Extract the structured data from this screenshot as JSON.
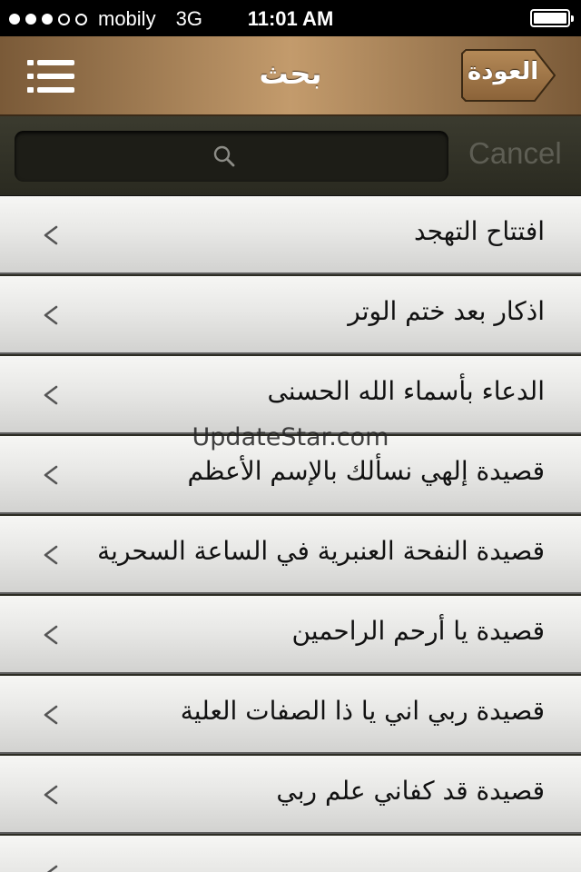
{
  "status_bar": {
    "carrier": "mobily",
    "network": "3G",
    "time": "11:01 AM",
    "signal_bars_filled": 3,
    "signal_bars_total": 5,
    "battery_level": 1.0
  },
  "navbar": {
    "title": "بحث",
    "back_label": "العودة",
    "menu_icon": "hamburger-menu-icon"
  },
  "search": {
    "placeholder": "",
    "value": "",
    "cancel_label": "Cancel",
    "icon": "search-icon"
  },
  "list": {
    "chevron_icon": "chevron-left-icon",
    "items": [
      {
        "label": "افتتاح التهجد"
      },
      {
        "label": "اذكار بعد ختم الوتر"
      },
      {
        "label": "الدعاء بأسماء الله الحسنى"
      },
      {
        "label": "قصيدة إلهي نسألك بالإسم الأعظم"
      },
      {
        "label": "قصيدة النفحة العنبرية في الساعة السحرية"
      },
      {
        "label": "قصيدة يا أرحم الراحمين"
      },
      {
        "label": "قصيدة ربي اني يا ذا الصفات العلية"
      },
      {
        "label": "قصيدة قد كفاني علم ربي"
      },
      {
        "label": ""
      }
    ]
  },
  "watermark": "UpdateStar.com",
  "colors": {
    "navbar_dark": "#7a5a38",
    "navbar_light": "#c39b6c",
    "searchbar": "#33332a",
    "row_light": "#f6f6f4",
    "row_dark": "#d2d2d0",
    "cancel_text": "#5e5e54"
  }
}
